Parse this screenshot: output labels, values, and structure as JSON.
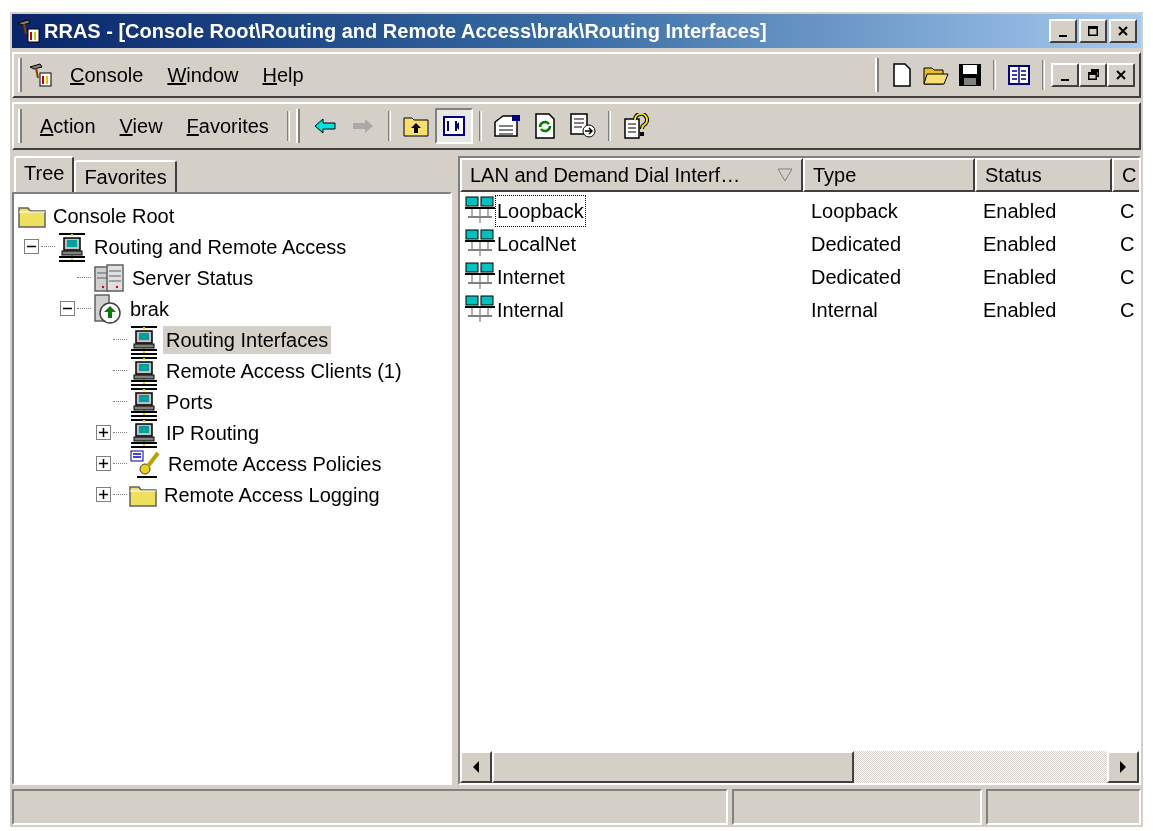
{
  "window": {
    "title": "RRAS - [Console Root\\Routing and Remote Access\\brak\\Routing Interfaces]",
    "controls": [
      {
        "kind": "minimize"
      },
      {
        "kind": "maximize"
      },
      {
        "kind": "close"
      }
    ]
  },
  "menu_bar": {
    "items": [
      "Console",
      "Window",
      "Help"
    ],
    "tools": [
      {
        "kind": "new"
      },
      {
        "kind": "open"
      },
      {
        "kind": "save"
      },
      {
        "kind": "view"
      }
    ],
    "child_controls": [
      {
        "kind": "minimize"
      },
      {
        "kind": "restore"
      },
      {
        "kind": "close"
      }
    ]
  },
  "action_bar": {
    "items": [
      "Action",
      "View",
      "Favorites"
    ],
    "tools": [
      {
        "kind": "back",
        "disabled": false,
        "pressed": false
      },
      {
        "kind": "forward",
        "disabled": true,
        "pressed": false
      },
      {
        "kind": "up",
        "disabled": false,
        "pressed": false
      },
      {
        "kind": "tree",
        "disabled": false,
        "pressed": true
      },
      {
        "kind": "properties",
        "disabled": false,
        "pressed": false
      },
      {
        "kind": "refresh",
        "disabled": false,
        "pressed": false
      },
      {
        "kind": "export",
        "disabled": false,
        "pressed": false
      },
      {
        "kind": "help",
        "disabled": false,
        "pressed": false
      }
    ]
  },
  "tabs": [
    {
      "label": "Tree",
      "selected": true
    },
    {
      "label": "Favorites",
      "selected": false
    }
  ],
  "tree": [
    {
      "label": "Console Root",
      "kind": "folder",
      "selected": false,
      "children": [
        {
          "label": "Routing and Remote Access",
          "kind": "network",
          "expanded": true,
          "selected": false,
          "children": [
            {
              "label": "Server Status",
              "kind": "servers",
              "selected": false
            },
            {
              "label": "brak",
              "kind": "server",
              "expanded": true,
              "selected": false,
              "children": [
                {
                  "label": "Routing Interfaces",
                  "kind": "network",
                  "selected": true
                },
                {
                  "label": "Remote Access Clients (1)",
                  "kind": "network",
                  "selected": false
                },
                {
                  "label": "Ports",
                  "kind": "network",
                  "selected": false
                },
                {
                  "label": "IP Routing",
                  "kind": "network",
                  "expanded": false,
                  "selected": false
                },
                {
                  "label": "Remote Access Policies",
                  "kind": "policy",
                  "expanded": false,
                  "selected": false
                },
                {
                  "label": "Remote Access Logging",
                  "kind": "folder",
                  "expanded": false,
                  "selected": false
                }
              ]
            }
          ]
        }
      ]
    }
  ],
  "list": {
    "columns": [
      "LAN and Demand Dial Interf…",
      "Type",
      "Status",
      "C"
    ],
    "rows": [
      {
        "name": "Loopback",
        "type": "Loopback",
        "status": "Enabled",
        "column_4": "C",
        "focused": true
      },
      {
        "name": "LocalNet",
        "type": "Dedicated",
        "status": "Enabled",
        "column_4": "C",
        "focused": false
      },
      {
        "name": "Internet",
        "type": "Dedicated",
        "status": "Enabled",
        "column_4": "C",
        "focused": false
      },
      {
        "name": "Internal",
        "type": "Internal",
        "status": "Enabled",
        "column_4": "C",
        "focused": false
      }
    ]
  }
}
